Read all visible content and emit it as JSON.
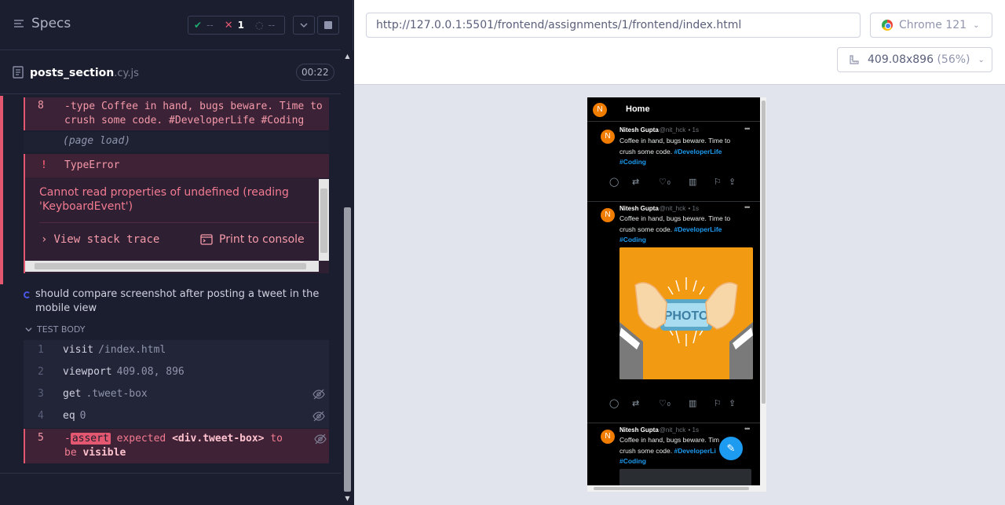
{
  "reporter": {
    "specs_label": "Specs",
    "stats": {
      "passed": "--",
      "failed": "1",
      "pending": "--"
    },
    "spec_name": "posts_section",
    "spec_ext": ".cy.js",
    "duration": "00:22",
    "failed_test": {
      "type_cmd": {
        "num": "8",
        "text_line1": "-type  Coffee in hand, bugs beware. Time to",
        "text_line2": "crush some code. #DeveloperLife #Coding"
      },
      "page_load": "(page load)",
      "error": {
        "bang": "!",
        "type": "TypeError",
        "message": "Cannot read properties of undefined (reading 'KeyboardEvent')",
        "stack_trace_label": "View stack trace",
        "print_label": "Print to console"
      }
    },
    "running_test": {
      "title": "should compare screenshot after posting a tweet in the mobile view",
      "body_label": "TEST BODY",
      "commands": [
        {
          "num": "1",
          "name": "visit",
          "arg": "/index.html"
        },
        {
          "num": "2",
          "name": "viewport",
          "arg": "409.08, 896"
        },
        {
          "num": "3",
          "name": "get",
          "arg": ".tweet-box"
        },
        {
          "num": "4",
          "name": "eq",
          "arg": "0"
        }
      ],
      "assert": {
        "num": "5",
        "prefix": "-",
        "badge": "assert",
        "word_expected": "expected",
        "subject": "<div.tweet-box>",
        "word_tobe": "to be",
        "result": "visible"
      }
    }
  },
  "aut": {
    "url": "http://127.0.0.1:5501/frontend/assignments/1/frontend/index.html",
    "browser": "Chrome 121",
    "viewport": "409.08x896",
    "scale": "(56%)"
  },
  "app": {
    "header_avatar": "N",
    "title": "Home",
    "tweets": [
      {
        "avatar": "N",
        "name": "Nitesh Gupta",
        "handle": "@nit_hck",
        "time": "• 1s",
        "text_line1": "Coffee in hand, bugs beware. Time to",
        "text_line2": "crush some code.",
        "tag1": "#DeveloperLife",
        "tag2": "#Coding",
        "like_count": "0"
      },
      {
        "avatar": "N",
        "name": "Nitesh Gupta",
        "handle": "@nit_hck",
        "time": "• 1s",
        "text_line1": "Coffee in hand, bugs beware. Time to",
        "text_line2": "crush some code.",
        "tag1": "#DeveloperLife",
        "tag2": "#Coding",
        "photo_label": "PHOTO",
        "like_count": "0"
      },
      {
        "avatar": "N",
        "name": "Nitesh Gupta",
        "handle": "@nit_hck",
        "time": "• 1s",
        "text_line1": "Coffee in hand, bugs beware. Tim",
        "text_line2": "crush some code.",
        "tag1": "#DeveloperLi",
        "tag2": "#Coding"
      }
    ]
  },
  "colors": {
    "reporter_bg": "#1b1e2e",
    "error_red": "#e45770",
    "pass_green": "#1fa971",
    "twitter_blue": "#1d9bf0",
    "avatar_orange": "#f07c00",
    "photo_orange": "#f39a13"
  }
}
